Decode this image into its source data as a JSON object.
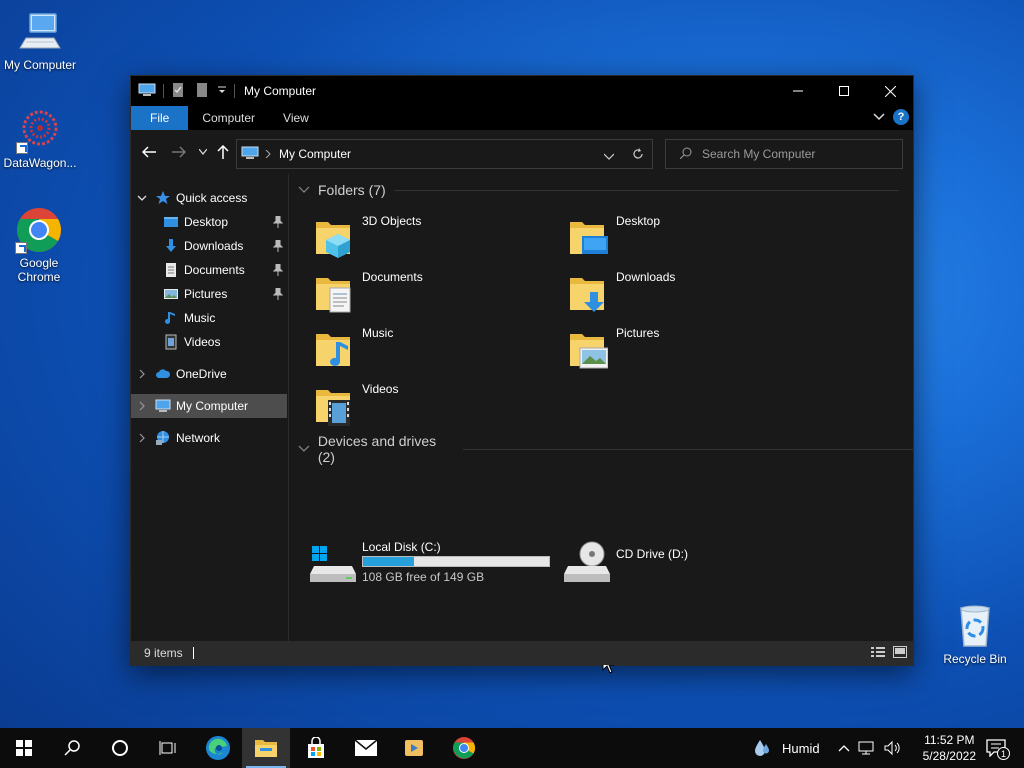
{
  "desktop": {
    "icons": [
      {
        "label": "My Computer"
      },
      {
        "label": "DataWagon..."
      },
      {
        "label_line1": "Google",
        "label_line2": "Chrome"
      },
      {
        "label": "Recycle Bin"
      }
    ]
  },
  "window": {
    "title": "My Computer",
    "ribbon_tabs": [
      "File",
      "Computer",
      "View"
    ],
    "address": "My Computer",
    "search_placeholder": "Search My Computer"
  },
  "sidebar": {
    "items": [
      {
        "label": "Quick access",
        "icon": "star-icon"
      },
      {
        "label": "Desktop",
        "icon": "desktop-folder-icon",
        "pinned": true
      },
      {
        "label": "Downloads",
        "icon": "download-icon",
        "pinned": true
      },
      {
        "label": "Documents",
        "icon": "document-icon",
        "pinned": true
      },
      {
        "label": "Pictures",
        "icon": "picture-icon",
        "pinned": true
      },
      {
        "label": "Music",
        "icon": "music-icon"
      },
      {
        "label": "Videos",
        "icon": "video-icon"
      },
      {
        "label": "OneDrive",
        "icon": "cloud-icon"
      },
      {
        "label": "My Computer",
        "icon": "computer-icon",
        "selected": true
      },
      {
        "label": "Network",
        "icon": "network-icon"
      }
    ]
  },
  "content": {
    "folders_header": "Folders (7)",
    "folders": [
      {
        "name": "3D Objects",
        "overlay": "cube-icon"
      },
      {
        "name": "Desktop",
        "overlay": "monitor-icon"
      },
      {
        "name": "Documents",
        "overlay": "document-icon"
      },
      {
        "name": "Downloads",
        "overlay": "download-arrow-icon"
      },
      {
        "name": "Music",
        "overlay": "music-note-icon"
      },
      {
        "name": "Pictures",
        "overlay": "landscape-icon"
      },
      {
        "name": "Videos",
        "overlay": "film-icon"
      }
    ],
    "drives_header": "Devices and drives (2)",
    "drives": [
      {
        "name": "Local Disk (C:)",
        "free": "108 GB free of 149 GB",
        "used_fraction": 0.275
      },
      {
        "name": "CD Drive (D:)"
      }
    ]
  },
  "status": {
    "items": "9 items"
  },
  "taskbar": {
    "weather": "Humid",
    "time": "11:52 PM",
    "date": "5/28/2022",
    "notifications": "1"
  },
  "colors": {
    "accent": "#1a73c7",
    "drive_bar": "#26a0da",
    "folder": "#f0c24c"
  }
}
